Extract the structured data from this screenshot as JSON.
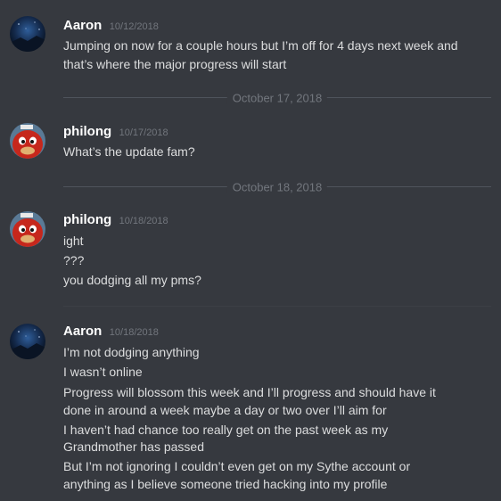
{
  "messages": [
    {
      "username": "Aaron",
      "timestamp": "10/12/2018",
      "avatar_icon": "night-sky-avatar",
      "lines": [
        "Jumping on now for a couple hours but I’m off for 4 days next week and",
        "that’s where the major progress will start"
      ]
    },
    {
      "username": "philong",
      "timestamp": "10/17/2018",
      "avatar_icon": "red-ugandan-knuckles-avatar",
      "lines": [
        "What’s the update fam?"
      ]
    },
    {
      "username": "philong",
      "timestamp": "10/18/2018",
      "avatar_icon": "red-ugandan-knuckles-avatar",
      "lines": [
        "ight",
        "???",
        "you dodging all my pms?"
      ]
    },
    {
      "username": "Aaron",
      "timestamp": "10/18/2018",
      "avatar_icon": "night-sky-avatar",
      "lines": [
        "I’m not dodging anything",
        "I wasn’t online",
        "Progress will blossom this week and I’ll progress and should have it",
        "done in around a week maybe a day or two over I’ll aim for",
        "I haven’t had chance too really get on the past week as my",
        "Grandmother has passed",
        "But I’m not ignoring I couldn’t even get on my Sythe account or",
        "anything as I believe someone tried hacking into my profile"
      ]
    }
  ],
  "dividers": [
    "October 17, 2018",
    "October 18, 2018"
  ],
  "colors": {
    "background": "#36393f",
    "username": "#ffffff",
    "message_text": "#dcddde",
    "timestamp": "#72767d",
    "divider": "#4f545c"
  }
}
